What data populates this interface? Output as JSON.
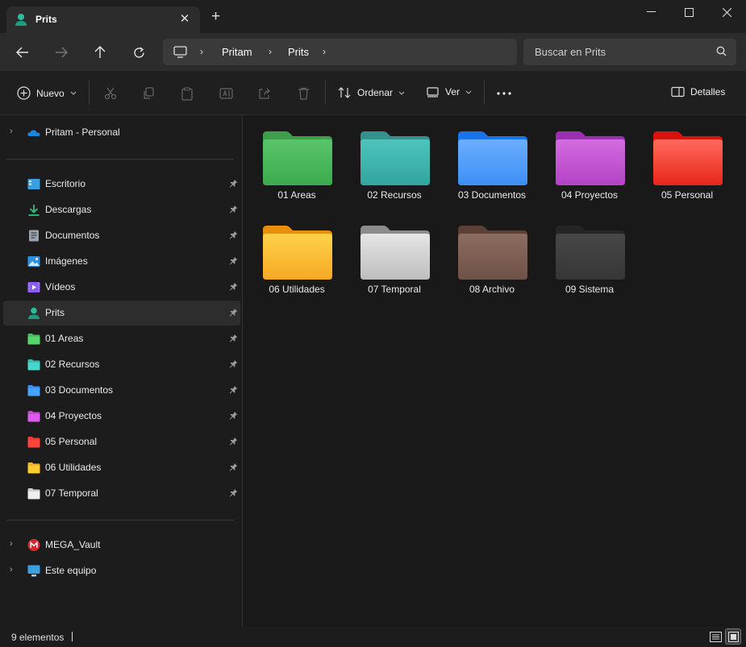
{
  "window": {
    "tab_title": "Prits",
    "tab_icon": "user-icon",
    "minimize_icon": "minimize-icon",
    "maximize_icon": "maximize-icon",
    "close_icon": "close-icon"
  },
  "navigation": {
    "breadcrumb": [
      "Pritam",
      "Prits"
    ],
    "search_placeholder": "Buscar en Prits"
  },
  "commandbar": {
    "new_label": "Nuevo",
    "sort_label": "Ordenar",
    "view_label": "Ver",
    "details_label": "Detalles"
  },
  "sidebar": {
    "cloud": {
      "label": "Pritam - Personal",
      "icon": "onedrive-icon"
    },
    "quick_access": [
      {
        "label": "Escritorio",
        "icon": "desktop-icon",
        "color": "#3aa0e0"
      },
      {
        "label": "Descargas",
        "icon": "download-icon",
        "color": "#2ec27e"
      },
      {
        "label": "Documentos",
        "icon": "document-icon",
        "color": "#9aa3ad"
      },
      {
        "label": "Imágenes",
        "icon": "image-icon",
        "color": "#2e8fe0"
      },
      {
        "label": "Vídeos",
        "icon": "video-icon",
        "color": "#8a5cf5"
      },
      {
        "label": "Prits",
        "icon": "user-icon",
        "color": "#2bbd9e"
      },
      {
        "label": "01 Areas",
        "icon": "folder-icon",
        "color": "#4cbb5c"
      },
      {
        "label": "02 Recursos",
        "icon": "folder-icon",
        "color": "#3fb9b0"
      },
      {
        "label": "03 Documentos",
        "icon": "folder-icon",
        "color": "#3d8ff5"
      },
      {
        "label": "04 Proyectos",
        "icon": "folder-icon",
        "color": "#c04fd0"
      },
      {
        "label": "05 Personal",
        "icon": "folder-icon",
        "color": "#ef3b32"
      },
      {
        "label": "06 Utilidades",
        "icon": "folder-icon",
        "color": "#f7b22a"
      },
      {
        "label": "07 Temporal",
        "icon": "folder-icon",
        "color": "#cfcfcf"
      }
    ],
    "other": [
      {
        "label": "MEGA_Vault",
        "icon": "mega-icon",
        "color": "#d9272e"
      },
      {
        "label": "Este equipo",
        "icon": "computer-icon",
        "color": "#3aa0e0"
      }
    ]
  },
  "folders": [
    {
      "label": "01 Areas",
      "top": "#3f9e4a",
      "front": "#5ac46a",
      "front2": "#3cab4c"
    },
    {
      "label": "02 Recursos",
      "top": "#34918b",
      "front": "#4cc5bc",
      "front2": "#32a59d"
    },
    {
      "label": "03 Documentos",
      "top": "#1a73e8",
      "front": "#6aaeff",
      "front2": "#3d8ff5"
    },
    {
      "label": "04 Proyectos",
      "top": "#9a2fb0",
      "front": "#d36ce0",
      "front2": "#b443c6"
    },
    {
      "label": "05 Personal",
      "top": "#d4130c",
      "front": "#ff6a5c",
      "front2": "#e8261b"
    },
    {
      "label": "06 Utilidades",
      "top": "#e98f0a",
      "front": "#ffd24a",
      "front2": "#f7a823"
    },
    {
      "label": "07 Temporal",
      "top": "#8c8c8c",
      "front": "#e6e6e6",
      "front2": "#bdbdbd"
    },
    {
      "label": "08 Archivo",
      "top": "#5a4037",
      "front": "#8c6c60",
      "front2": "#6e5248"
    },
    {
      "label": "09 Sistema",
      "top": "#252525",
      "front": "#474747",
      "front2": "#363636"
    }
  ],
  "status": {
    "count_text": "9 elementos"
  }
}
